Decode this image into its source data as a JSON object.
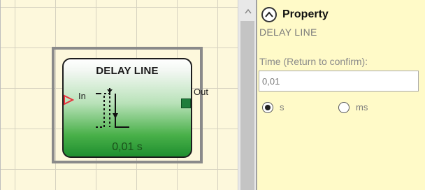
{
  "block": {
    "title": "DELAY LINE",
    "input_label": "In",
    "output_label": "Out",
    "value": "0,01 s"
  },
  "property_panel": {
    "title": "Property",
    "component_name": "DELAY LINE",
    "time_label": "Time (Return to confirm):",
    "time_value": "0,01",
    "unit_options": [
      {
        "label": "s",
        "selected": true
      },
      {
        "label": "ms",
        "selected": false
      }
    ]
  },
  "colors": {
    "canvas_bg": "#fdf8dc",
    "panel_bg": "#fffac8",
    "block_green": "#1f8f2f",
    "input_arrow": "#e8323c",
    "output_port": "#1e7d3b"
  },
  "icons": {
    "collapse": "chevron-up-icon",
    "scroll_up": "scroll-up-arrow-icon"
  }
}
